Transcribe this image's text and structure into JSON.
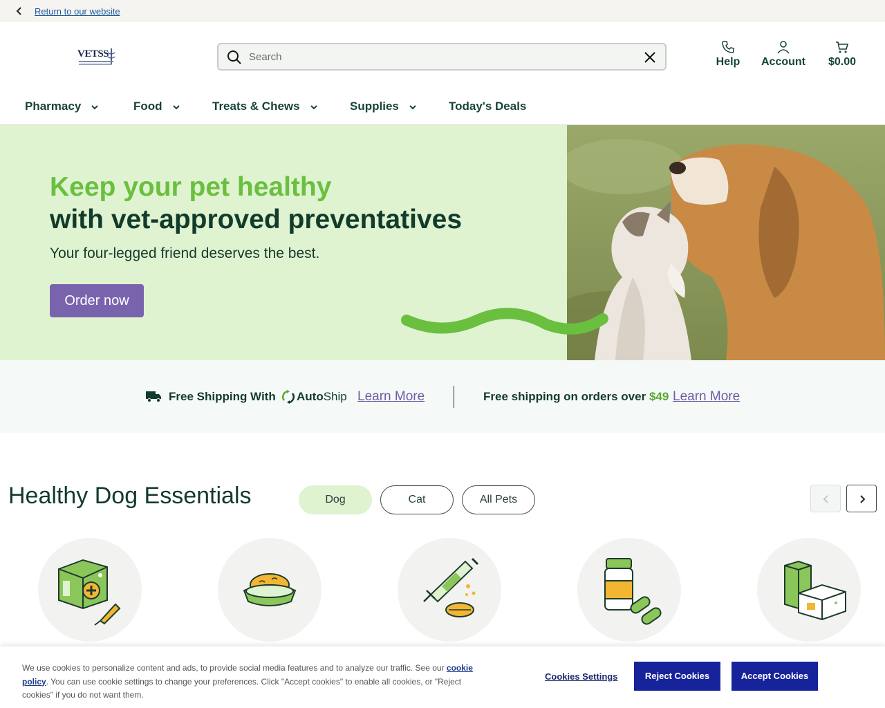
{
  "topbar": {
    "return_link": "Return to our website"
  },
  "header": {
    "logo_text": "VETSS",
    "search_placeholder": "Search",
    "help_label": "Help",
    "account_label": "Account",
    "cart_total": "$0.00"
  },
  "nav": {
    "items": [
      {
        "label": "Pharmacy",
        "has_dropdown": true
      },
      {
        "label": "Food",
        "has_dropdown": true
      },
      {
        "label": "Treats & Chews",
        "has_dropdown": true
      },
      {
        "label": "Supplies",
        "has_dropdown": true
      },
      {
        "label": "Today's Deals",
        "has_dropdown": false
      }
    ]
  },
  "hero": {
    "headline_line1": "Keep your pet healthy",
    "headline_line2": "with vet-approved preventatives",
    "subtitle": "Your four-legged friend deserves the best.",
    "cta": "Order now",
    "colors": {
      "accent": "#6abf3f",
      "background": "#dff3d1",
      "cta": "#7a63ad"
    }
  },
  "shipping": {
    "autoship_text": "Free Shipping With",
    "autoship_brand_bold": "Auto",
    "autoship_brand_rest": "Ship",
    "learn_more_1": "Learn More",
    "threshold_text": "Free shipping on orders over",
    "threshold_price": "$49",
    "learn_more_2": "Learn More"
  },
  "essentials": {
    "title": "Healthy Dog Essentials",
    "filters": [
      {
        "label": "Dog",
        "active": true
      },
      {
        "label": "Cat",
        "active": false
      },
      {
        "label": "All Pets",
        "active": false
      }
    ],
    "categories": [
      {
        "icon": "flea-tick-medication-icon"
      },
      {
        "icon": "food-bowl-icon"
      },
      {
        "icon": "syringe-pill-icon"
      },
      {
        "icon": "pill-bottle-icon"
      },
      {
        "icon": "supply-boxes-icon"
      }
    ]
  },
  "cookie_banner": {
    "text_before": "We use cookies to personalize content and ads, to provide social media features and to analyze our traffic. See our ",
    "policy_link": "cookie policy",
    "text_after": ". You can use cookie settings to change your preferences. Click \"Accept cookies\" to enable all cookies, or \"Reject cookies\" if you do not want them.",
    "settings_label": "Cookies Settings",
    "reject_label": "Reject Cookies",
    "accept_label": "Accept Cookies"
  }
}
